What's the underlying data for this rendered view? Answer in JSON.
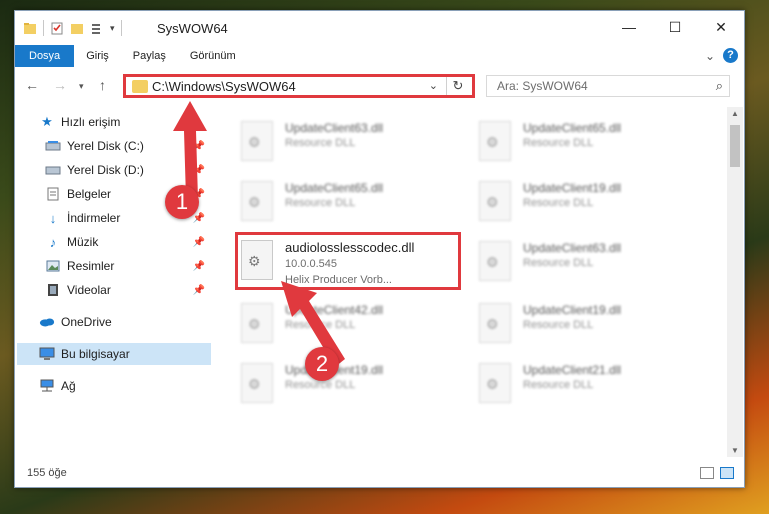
{
  "window": {
    "title": "SysWOW64",
    "controls": {
      "minimize": "—",
      "maximize": "☐",
      "close": "✕"
    }
  },
  "ribbon": {
    "tabs": [
      "Dosya",
      "Giriş",
      "Paylaş",
      "Görünüm"
    ],
    "expand_glyph": "⌄",
    "help_glyph": "?"
  },
  "address": {
    "path": "C:\\Windows\\SysWOW64",
    "search_placeholder": "Ara: SysWOW64"
  },
  "nav": {
    "quick_access": "Hızlı erişim",
    "items": [
      {
        "label": "Yerel Disk (C:)",
        "icon": "drive-icon",
        "pinned": true
      },
      {
        "label": "Yerel Disk (D:)",
        "icon": "drive-icon",
        "pinned": true
      },
      {
        "label": "Belgeler",
        "icon": "documents-icon",
        "pinned": true
      },
      {
        "label": "İndirmeler",
        "icon": "download-icon",
        "pinned": true
      },
      {
        "label": "Müzik",
        "icon": "music-icon",
        "pinned": true
      },
      {
        "label": "Resimler",
        "icon": "pictures-icon",
        "pinned": true
      },
      {
        "label": "Videolar",
        "icon": "videos-icon",
        "pinned": true
      }
    ],
    "onedrive": "OneDrive",
    "this_pc": "Bu bilgisayar",
    "network": "Ağ"
  },
  "files": {
    "highlighted": {
      "name": "audiolosslesscodec.dll",
      "version": "10.0.0.545",
      "description": "Helix Producer Vorb..."
    },
    "left_column": [
      {
        "name": "UpdateClient63.dll",
        "type": "Resource DLL"
      },
      {
        "name": "UpdateClient65.dll",
        "type": "Resource DLL"
      },
      {
        "name": "UpdateClient42.dll",
        "type": "Resource DLL"
      },
      {
        "name": "UpdateClient19.dll",
        "type": "Resource DLL"
      }
    ],
    "right_column": [
      {
        "name": "UpdateClient65.dll",
        "type": "Resource DLL"
      },
      {
        "name": "UpdateClient19.dll",
        "type": "Resource DLL"
      },
      {
        "name": "UpdateClient63.dll",
        "type": "Resource DLL"
      },
      {
        "name": "UpdateClient19.dll",
        "type": "Resource DLL"
      },
      {
        "name": "UpdateClient21.dll",
        "type": "Resource DLL"
      }
    ]
  },
  "status": {
    "count": "155 öğe"
  },
  "annotations": {
    "step1": "1",
    "step2": "2",
    "color": "#e0393e"
  }
}
